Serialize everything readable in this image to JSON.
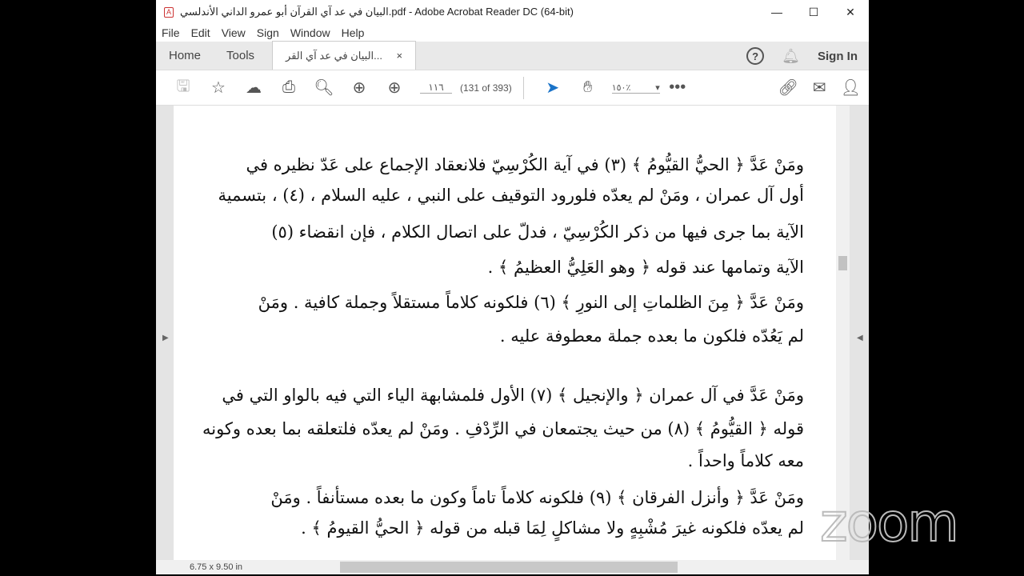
{
  "window": {
    "title": "البيان في عد آي القرآن أبو عمرو الداني الأندلسي.pdf - Adobe Acrobat Reader DC (64-bit)",
    "minimize": "—",
    "maximize": "☐",
    "close": "✕"
  },
  "menu": [
    "File",
    "Edit",
    "View",
    "Sign",
    "Window",
    "Help"
  ],
  "tabs": {
    "home": "Home",
    "tools": "Tools",
    "doc": "البيان في عد آي القر...",
    "close": "×",
    "signin": "Sign In"
  },
  "toolbar": {
    "page_input": "١١٦",
    "page_count": "(131 of 393)",
    "zoom": "١٥٠٪"
  },
  "page": {
    "lines": [
      "ومَنْ عَدَّ ﴿ الحيُّ القيُّومُ ﴾ (٣) في آية الكُرْسِيّ فلانعقاد الإجماع على عَدّ نظيره في",
      "أول آل عمران ، ومَنْ لم يعدّه فلورود التوقيف على النبي ، عليه السلام ، (٤) ، بتسمية",
      "الآية بما جرى فيها من ذكر الكُرْسِيّ ، فدلّ على اتصال الكلام ، فإن انقضاء (٥)",
      "الآية وتمامها عند قوله ﴿ وهو العَلِيُّ العظيمُ ﴾ .",
      "ومَنْ عَدَّ ﴿ مِنَ الظلماتِ إلى النورِ ﴾ (٦) فلكونه كلاماً مستقلاً وجملة كافية . ومَنْ",
      "لم يَعُدّه فلكون ما بعده جملة معطوفة عليه .",
      "ومَنْ عَدَّ في آل عمران ﴿ والإنجيل ﴾ (٧) الأول فلمشابهة الياء التي فيه بالواو التي في",
      "قوله ﴿ القيُّومُ ﴾ (٨) من حيث يجتمعان في الرِّدْفِ . ومَنْ لم يعدّه فلتعلقه بما بعده وكونه",
      "معه كلاماً واحداً .",
      "ومَنْ عَدَّ ﴿ وأنزل الفرقان ﴾ (٩) فلكونه كلاماً تاماً وكون ما بعده مستأنفاً . ومَنْ",
      "لم يعدّه فلكونه غيرَ مُشْبِهٍ ولا مشاكلٍ لِمَا قبله من قوله ﴿ الحيُّ القيومُ ﴾ ."
    ]
  },
  "status": {
    "page_size": "6.75 x 9.50 in"
  },
  "overlay": {
    "logo": "zoom"
  }
}
